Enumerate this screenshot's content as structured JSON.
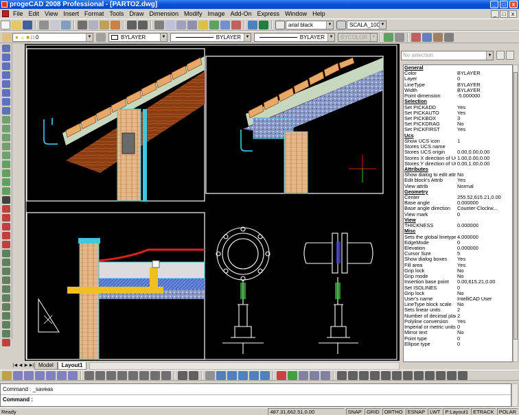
{
  "app": {
    "title": "progeCAD 2008 Professional - [PARTO2.dwg]",
    "window_buttons": [
      "_",
      "□",
      "x"
    ],
    "mdi_buttons": [
      "_",
      "□",
      "x"
    ]
  },
  "menu": [
    "File",
    "Edit",
    "View",
    "Insert",
    "Format",
    "Tools",
    "Draw",
    "Dimension",
    "Modify",
    "Image",
    "Add-On",
    "Express",
    "Window",
    "Help"
  ],
  "toolbar1": {
    "font_combo": "arial black",
    "dimstyle_combo": "SCALA_100"
  },
  "toolbar2": {
    "layer_combo": "0",
    "color_combo": "BYLAYER",
    "linetype_combo": "BYLAYER",
    "lineweight_combo": "BYLAYER",
    "plotstyle_combo": "BYCOLOR"
  },
  "layout_tabs": {
    "nav": [
      "|◀",
      "◀",
      "▶",
      "▶|"
    ],
    "tabs": [
      {
        "label": "Model",
        "active": false
      },
      {
        "label": "Layout1",
        "active": true
      }
    ]
  },
  "properties": {
    "selection": "No selection",
    "groups": [
      {
        "name": "General",
        "rows": [
          {
            "name": "Color",
            "value": "BYLAYER"
          },
          {
            "name": "Layer",
            "value": "0"
          },
          {
            "name": "LineType",
            "value": "BYLAYER"
          },
          {
            "name": "Width",
            "value": "BYLAYER"
          },
          {
            "name": "Point dimension",
            "value": "-5.000000"
          }
        ]
      },
      {
        "name": "Selection",
        "rows": [
          {
            "name": "Set PICKADD",
            "value": "Yes"
          },
          {
            "name": "Set PICKAUTO",
            "value": "Yes"
          },
          {
            "name": "Set PICKBOX",
            "value": "3"
          },
          {
            "name": "Set PICKDRAG",
            "value": "No"
          },
          {
            "name": "Set PICKFIRST",
            "value": "Yes"
          }
        ]
      },
      {
        "name": "Ucs",
        "rows": [
          {
            "name": "Show UCS icon",
            "value": "1"
          },
          {
            "name": "Stores UCS name",
            "value": ""
          },
          {
            "name": "Stores UCS origin",
            "value": "0.00,0.00,0.00"
          },
          {
            "name": "Stores X direction of UCS",
            "value": "1.00,0.00,0.00"
          },
          {
            "name": "Stores Y direction of UCS",
            "value": "0.00,1.00,0.00"
          }
        ]
      },
      {
        "name": "Attributes",
        "rows": [
          {
            "name": "Show dialog to edit attrib",
            "value": "No"
          },
          {
            "name": "Edit block's Attrib",
            "value": "Yes"
          },
          {
            "name": "View attrib",
            "value": "Normal"
          }
        ]
      },
      {
        "name": "Geometry",
        "rows": [
          {
            "name": "Center",
            "value": "255.52,615.21,0.00"
          },
          {
            "name": "Base angle",
            "value": "0.000000"
          },
          {
            "name": "Base angle direction",
            "value": "Counter-Clockw..."
          },
          {
            "name": "View mark",
            "value": "0"
          }
        ]
      },
      {
        "name": "View",
        "rows": [
          {
            "name": "THICKNESS",
            "value": "0.000000"
          }
        ]
      },
      {
        "name": "Misc",
        "rows": [
          {
            "name": "Sets the global linetype ...",
            "value": "4.000000"
          },
          {
            "name": "EdgeMode",
            "value": "0"
          },
          {
            "name": "Elevation",
            "value": "0.000000"
          },
          {
            "name": "Cursor Size",
            "value": "5"
          },
          {
            "name": "Show dialog boxes",
            "value": "Yes"
          },
          {
            "name": "Fill area",
            "value": "Yes"
          },
          {
            "name": "Grip lock",
            "value": "No"
          },
          {
            "name": "Grip mode",
            "value": "No"
          },
          {
            "name": "Insertion base point",
            "value": "0.00,615.21,0.00"
          },
          {
            "name": "Set ISOLINES",
            "value": "0"
          },
          {
            "name": "Grip lock",
            "value": "No"
          },
          {
            "name": "User's name",
            "value": "IntelliCAD User"
          },
          {
            "name": "LineType block scale",
            "value": "No"
          },
          {
            "name": "Sets linear units",
            "value": "2"
          },
          {
            "name": "Number of decimal places",
            "value": "2"
          },
          {
            "name": "Polyline conversion",
            "value": "Yes"
          },
          {
            "name": "Imperial or metric units",
            "value": "0"
          },
          {
            "name": "Mirror text",
            "value": "No"
          },
          {
            "name": "Point type",
            "value": "0"
          },
          {
            "name": "Ellipse type",
            "value": "0"
          }
        ]
      }
    ]
  },
  "command": {
    "history": "Command : _saveas",
    "prompt": "Command :"
  },
  "status": {
    "ready": "Ready",
    "coords": "487.31,662.51,0.00",
    "toggles": [
      "SNAP",
      "GRID",
      "ORTHO",
      "ESNAP",
      "LWT",
      "P:Layout1",
      "ETRACK",
      "POLAR"
    ]
  },
  "colors": {
    "titlebar": "#0a55d8",
    "canvas": "#000000",
    "chrome": "#d4d0c8",
    "tile_orange": "#e8a868",
    "wood": "#8a3c12",
    "insulation_blue": "#4a6ccc",
    "pipe_yellow": "#f0c020",
    "waterproof_red": "#e02020"
  }
}
